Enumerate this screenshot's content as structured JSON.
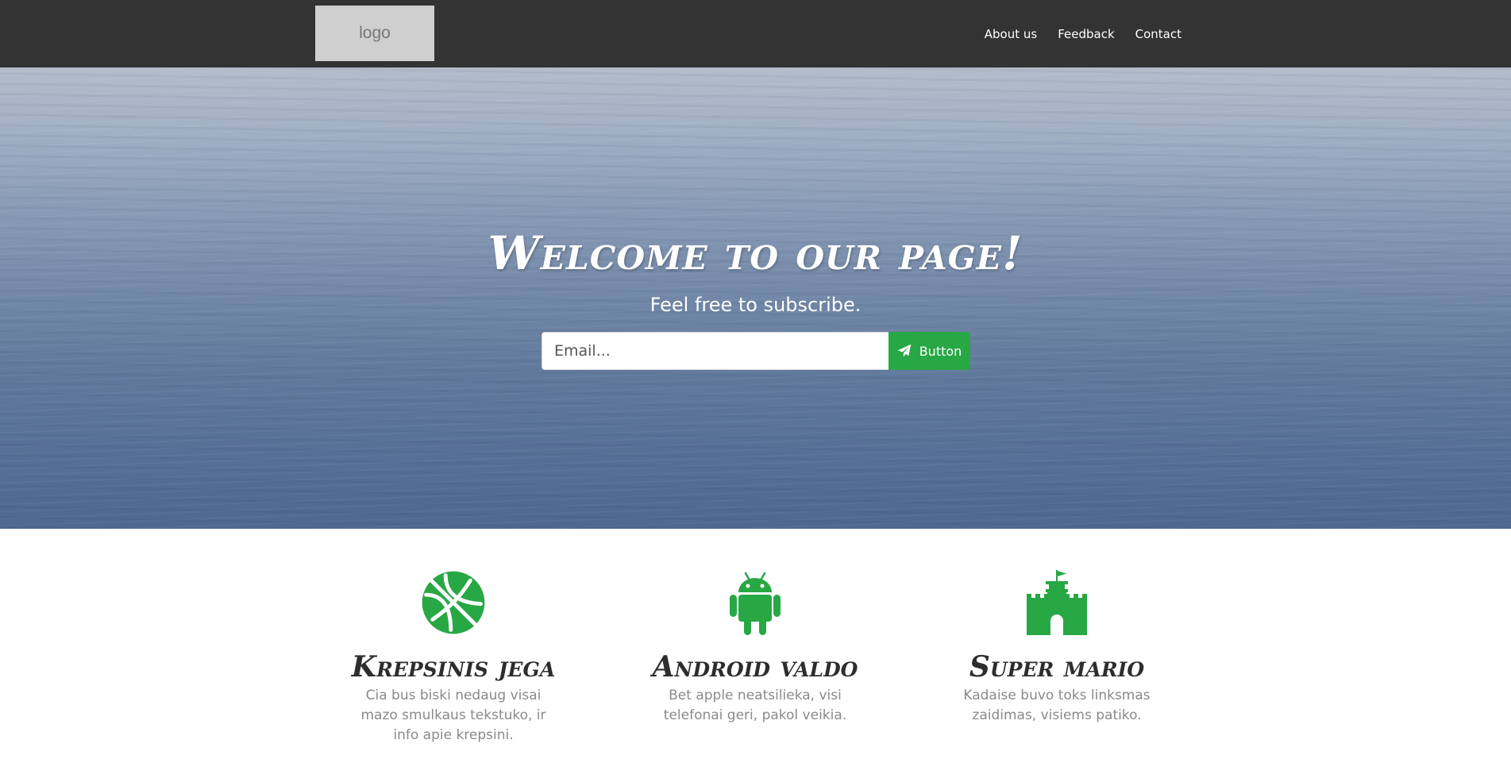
{
  "navbar": {
    "logo_text": "logo",
    "links": [
      {
        "label": "About us"
      },
      {
        "label": "Feedback"
      },
      {
        "label": "Contact"
      }
    ]
  },
  "hero": {
    "title": "Welcome to our page!",
    "subtitle": "Feel free to subscribe.",
    "email_placeholder": "Email...",
    "button_label": "Button",
    "button_icon": "paper-plane-icon",
    "button_color": "#28a745"
  },
  "features": [
    {
      "icon": "basketball-icon",
      "title": "Krepsinis jega",
      "text": "Cia bus biski nedaug visai mazo smulkaus tekstuko, ir info apie krepsini."
    },
    {
      "icon": "android-icon",
      "title": "Android valdo",
      "text": "Bet apple neatsilieka, visi telefonai geri, pakol veikia."
    },
    {
      "icon": "castle-icon",
      "title": "Super mario",
      "text": "Kadaise buvo toks linksmas zaidimas, visiems patiko."
    }
  ],
  "colors": {
    "navbar_bg": "#333333",
    "accent": "#28a745",
    "heading_dark": "#2d2d2d",
    "body_muted": "#8a8a8a"
  }
}
